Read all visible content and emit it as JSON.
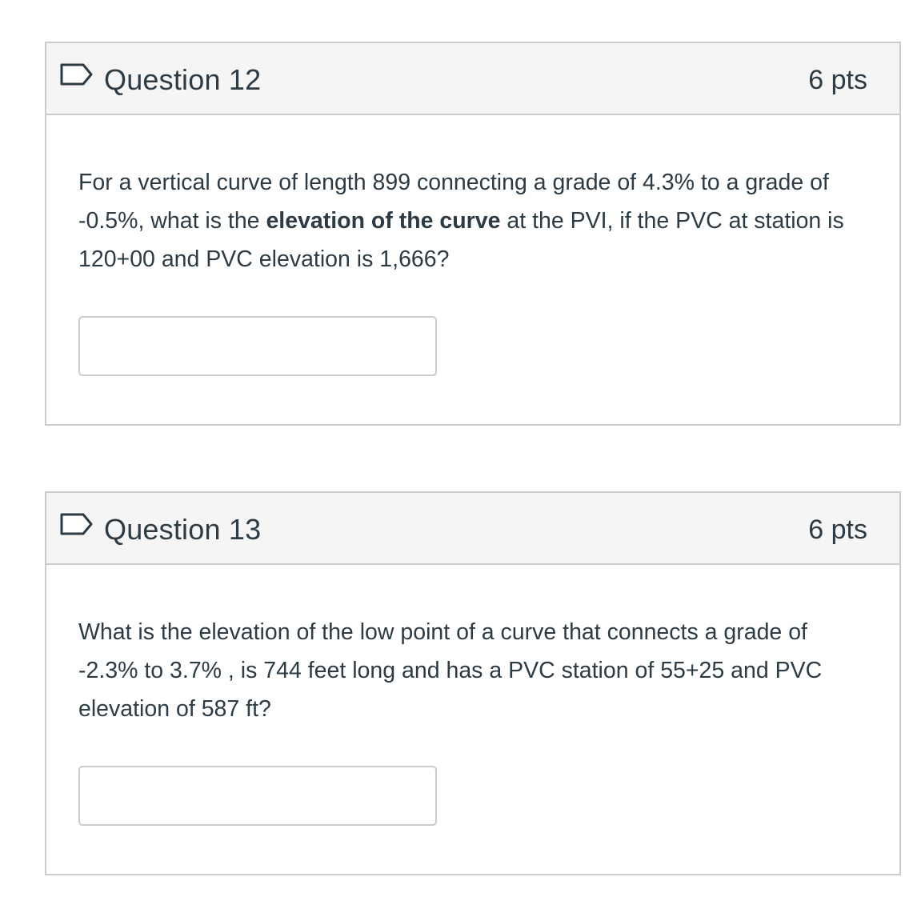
{
  "questions": [
    {
      "title": "Question 12",
      "points": "6 pts",
      "text_before": "For a vertical curve of length 899 connecting a grade of 4.3% to a grade of -0.5%, what is the ",
      "text_bold": "elevation of the curve",
      "text_after": " at the PVI, if the PVC at station is  120+00 and PVC elevation is 1,666?",
      "answer_value": ""
    },
    {
      "title": "Question 13",
      "points": "6 pts",
      "text": "What is the elevation of the low point of a curve  that connects a grade of -2.3% to 3.7% , is 744 feet long and has a PVC station of 55+25 and PVC elevation of 587 ft?",
      "answer_value": ""
    }
  ],
  "colors": {
    "border": "#c7cdd1",
    "header_bg": "#f5f5f5",
    "text": "#2d3b45",
    "flag": "#2d3b45"
  },
  "icons": {
    "flag": "bookmark-flag-icon"
  }
}
